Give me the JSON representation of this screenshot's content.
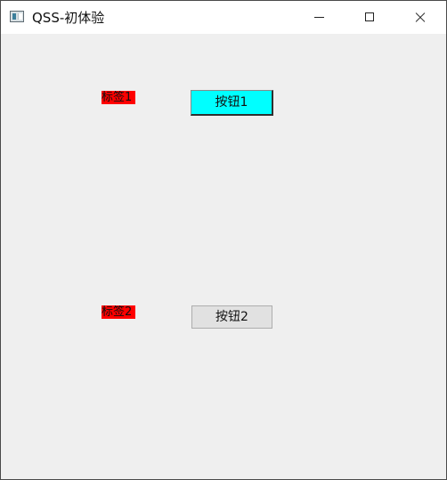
{
  "window": {
    "title": "QSS-初体验"
  },
  "title_controls": {
    "minimize_icon": "minimize-icon",
    "maximize_icon": "maximize-icon",
    "close_icon": "close-icon"
  },
  "content": {
    "labels": [
      {
        "text": "标签1",
        "background": "#ff0000"
      },
      {
        "text": "标签2",
        "background": "#ff0000"
      }
    ],
    "buttons": [
      {
        "text": "按钮1",
        "background": "#00ffff"
      },
      {
        "text": "按钮2",
        "background": "#e1e1e1"
      }
    ]
  }
}
